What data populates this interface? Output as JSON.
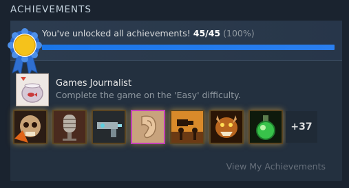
{
  "header": {
    "title": "ACHIEVEMENTS"
  },
  "summary": {
    "text": "You've unlocked all achievements!",
    "count": "45/45",
    "percent": "(100%)",
    "progress_fraction": 1.0,
    "medal_icon": "gold-medal-ribbon-icon"
  },
  "featured": {
    "title": "Games Journalist",
    "description": "Complete the game on the 'Easy' difficulty.",
    "icon": "fishbowl-icon"
  },
  "achievements": [
    {
      "icon": "skull-icon"
    },
    {
      "icon": "microphone-icon"
    },
    {
      "icon": "gun-icon"
    },
    {
      "icon": "ear-icon"
    },
    {
      "icon": "camera-crew-icon"
    },
    {
      "icon": "demon-face-icon"
    },
    {
      "icon": "potion-flask-icon"
    }
  ],
  "more": "+37",
  "view_link": "View My Achievements",
  "colors": {
    "accent_blue": "#1a75e8",
    "glow_gold": "#ffbe46",
    "background": "#1a232f"
  }
}
